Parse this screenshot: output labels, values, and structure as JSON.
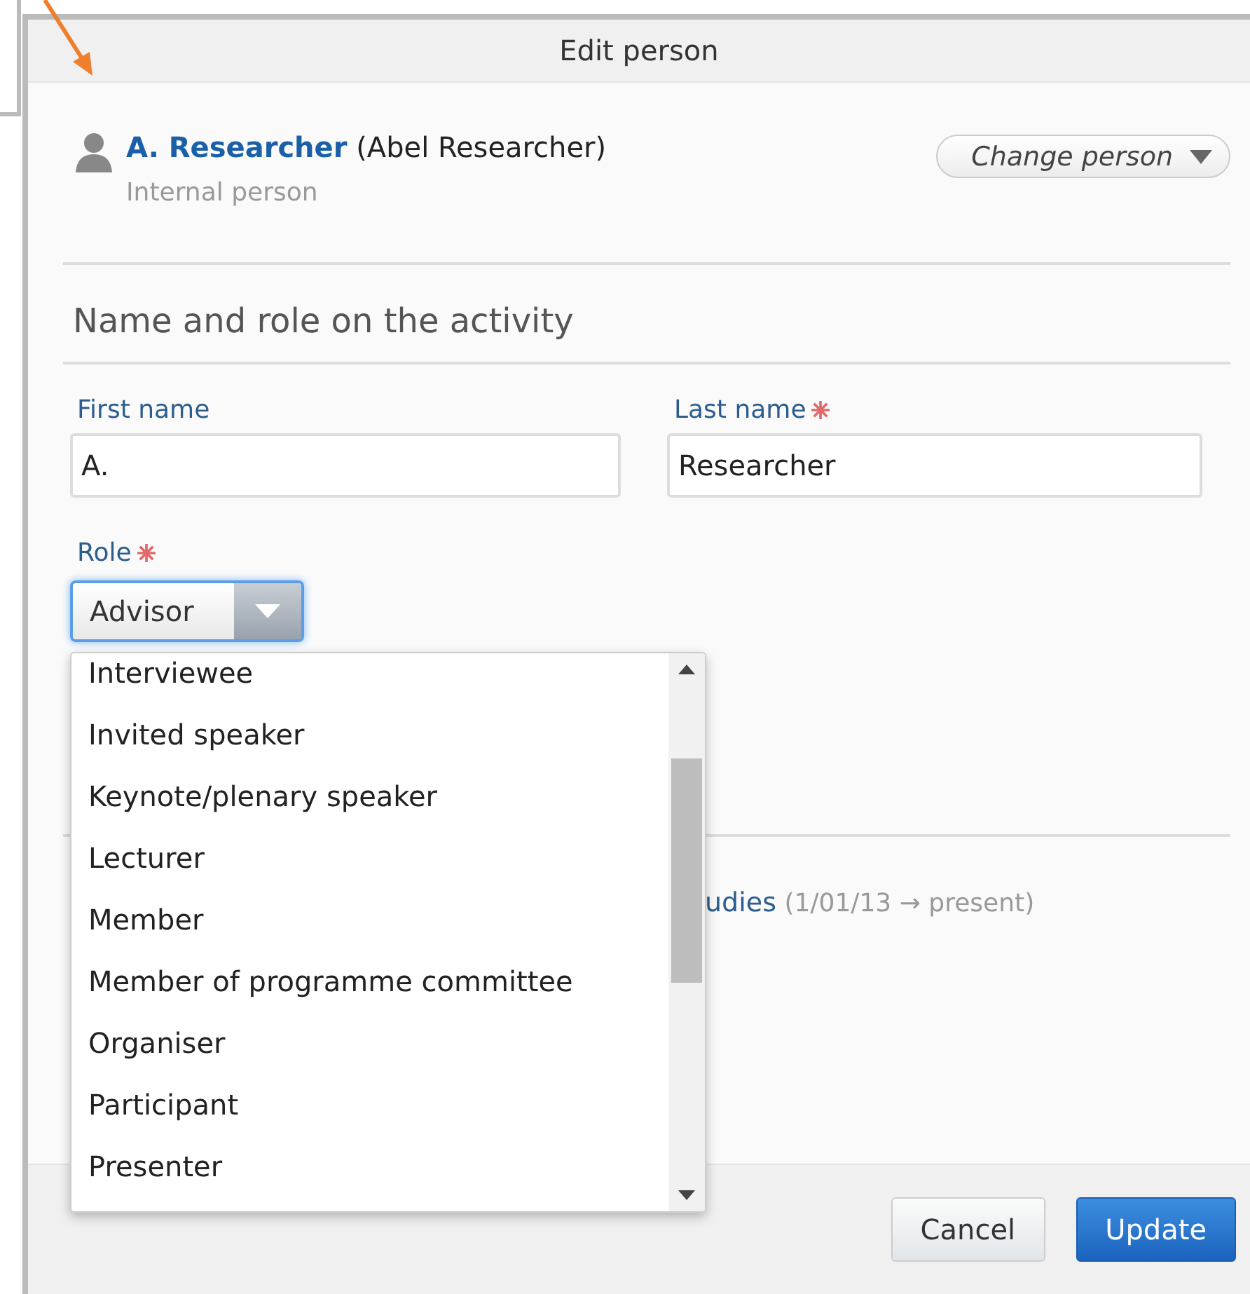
{
  "dialog": {
    "title": "Edit person"
  },
  "person": {
    "name": "A. Researcher",
    "full_name": "(Abel Researcher)",
    "type": "Internal person",
    "change_button": "Change person"
  },
  "section": {
    "title": "Name and role on the activity"
  },
  "fields": [
    {
      "label": "First name",
      "required": false,
      "value": "A."
    },
    {
      "label": "Last name",
      "required": true,
      "value": "Researcher"
    }
  ],
  "role": {
    "label": "Role",
    "required": true,
    "value": "Advisor",
    "expanded": true,
    "options": [
      {
        "label": "Interviewee",
        "selected": false
      },
      {
        "label": "Invited speaker",
        "selected": false
      },
      {
        "label": "Keynote/plenary speaker",
        "selected": false
      },
      {
        "label": "Lecturer",
        "selected": false
      },
      {
        "label": "Member",
        "selected": false
      },
      {
        "label": "Member of programme committee",
        "selected": false
      },
      {
        "label": "Organiser",
        "selected": false
      },
      {
        "label": "Participant",
        "selected": false
      },
      {
        "label": "Presenter",
        "selected": false
      }
    ]
  },
  "affiliation": {
    "link": "udies",
    "period": "(1/01/13 → present)"
  },
  "buttons": [
    {
      "label": "Cancel",
      "kind": "secondary"
    },
    {
      "label": "Update",
      "kind": "primary"
    }
  ]
}
